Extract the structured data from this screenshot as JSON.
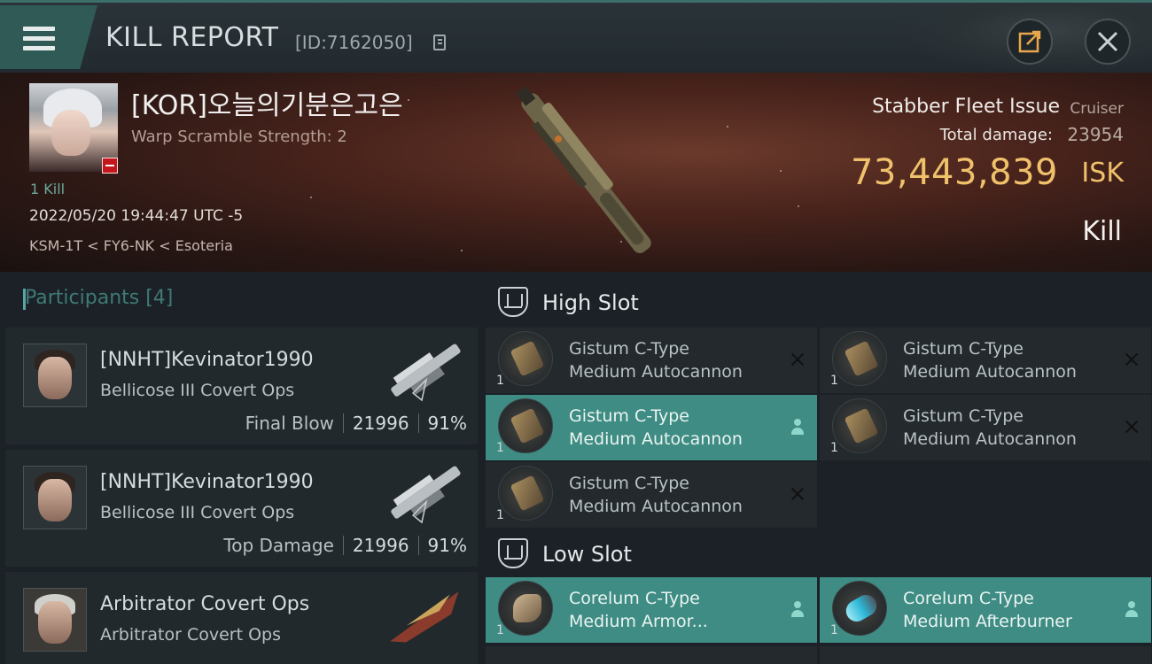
{
  "header": {
    "title": "KILL REPORT",
    "report_id": "[ID:7162050]"
  },
  "victim": {
    "name": "[KOR]오늘의기분은고은",
    "warp_scramble": "Warp Scramble Strength: 2",
    "kill_count": "1 Kill",
    "datetime": "2022/05/20 19:44:47 UTC -5",
    "location": "KSM-1T < FY6-NK < Esoteria",
    "ship_name": "Stabber Fleet Issue",
    "ship_class": "Cruiser",
    "total_damage_label": "Total damage:",
    "total_damage_value": "23954",
    "isk_value": "73,443,839",
    "isk_unit": "ISK",
    "result": "Kill"
  },
  "participants": {
    "label": "Participants [4]",
    "items": [
      {
        "name": "[NNHT]Kevinator1990",
        "ship": "Bellicose III Covert Ops",
        "role": "Final Blow",
        "damage": "21996",
        "percent": "91%"
      },
      {
        "name": "[NNHT]Kevinator1990",
        "ship": "Bellicose III Covert Ops",
        "role": "Top Damage",
        "damage": "21996",
        "percent": "91%"
      },
      {
        "name": "Arbitrator Covert Ops",
        "ship": "Arbitrator Covert Ops",
        "role": "",
        "damage": "",
        "percent": ""
      }
    ]
  },
  "slots": {
    "high": {
      "title": "High Slot",
      "modules": [
        {
          "line1": "Gistum C-Type",
          "line2": "Medium Autocannon",
          "qty": "1",
          "state": "destroyed"
        },
        {
          "line1": "Gistum C-Type",
          "line2": "Medium Autocannon",
          "qty": "1",
          "state": "destroyed"
        },
        {
          "line1": "Gistum C-Type",
          "line2": "Medium Autocannon",
          "qty": "1",
          "state": "dropped"
        },
        {
          "line1": "Gistum C-Type",
          "line2": "Medium Autocannon",
          "qty": "1",
          "state": "destroyed"
        },
        {
          "line1": "Gistum C-Type",
          "line2": "Medium Autocannon",
          "qty": "1",
          "state": "destroyed"
        }
      ]
    },
    "low": {
      "title": "Low Slot",
      "modules": [
        {
          "line1": "Corelum C-Type",
          "line2": "Medium Armor...",
          "qty": "1",
          "state": "dropped"
        },
        {
          "line1": "Corelum C-Type",
          "line2": "Medium Afterburner",
          "qty": "1",
          "state": "dropped"
        }
      ]
    }
  },
  "colors": {
    "accent": "#3e8c83",
    "isk_gold": "#f0c16b",
    "loss_red": "#c4161c"
  },
  "icons": {
    "menu": "hamburger-icon",
    "share": "share-icon",
    "close": "close-icon",
    "copy": "copy-icon",
    "slot": "slot-icon",
    "destroyed": "x-icon",
    "dropped": "person-icon"
  }
}
